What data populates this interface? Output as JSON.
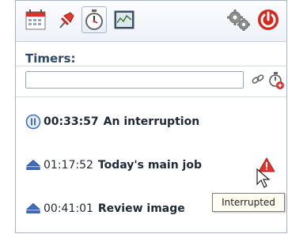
{
  "section": {
    "title": "Timers:"
  },
  "search": {
    "value": "",
    "placeholder": ""
  },
  "timers": [
    {
      "status": "paused",
      "time": "00:33:57",
      "name": "An interruption"
    },
    {
      "status": "stopped",
      "time": "01:17:52",
      "name": "Today's main job"
    },
    {
      "status": "stopped",
      "time": "00:41:01",
      "name": "Review image"
    }
  ],
  "tooltip": {
    "text": "Interrupted"
  },
  "colors": {
    "accent": "#2f4a66",
    "power": "#d9261c",
    "eject_blue": "#3d6fc4",
    "warning_red": "#e0342c"
  },
  "icons": {
    "toolbar": [
      "calendar-icon",
      "pin-icon",
      "stopwatch-icon",
      "chart-monitor-icon",
      "gears-icon",
      "power-icon"
    ],
    "search_actions": [
      "clear-link-icon",
      "add-timer-icon"
    ]
  }
}
